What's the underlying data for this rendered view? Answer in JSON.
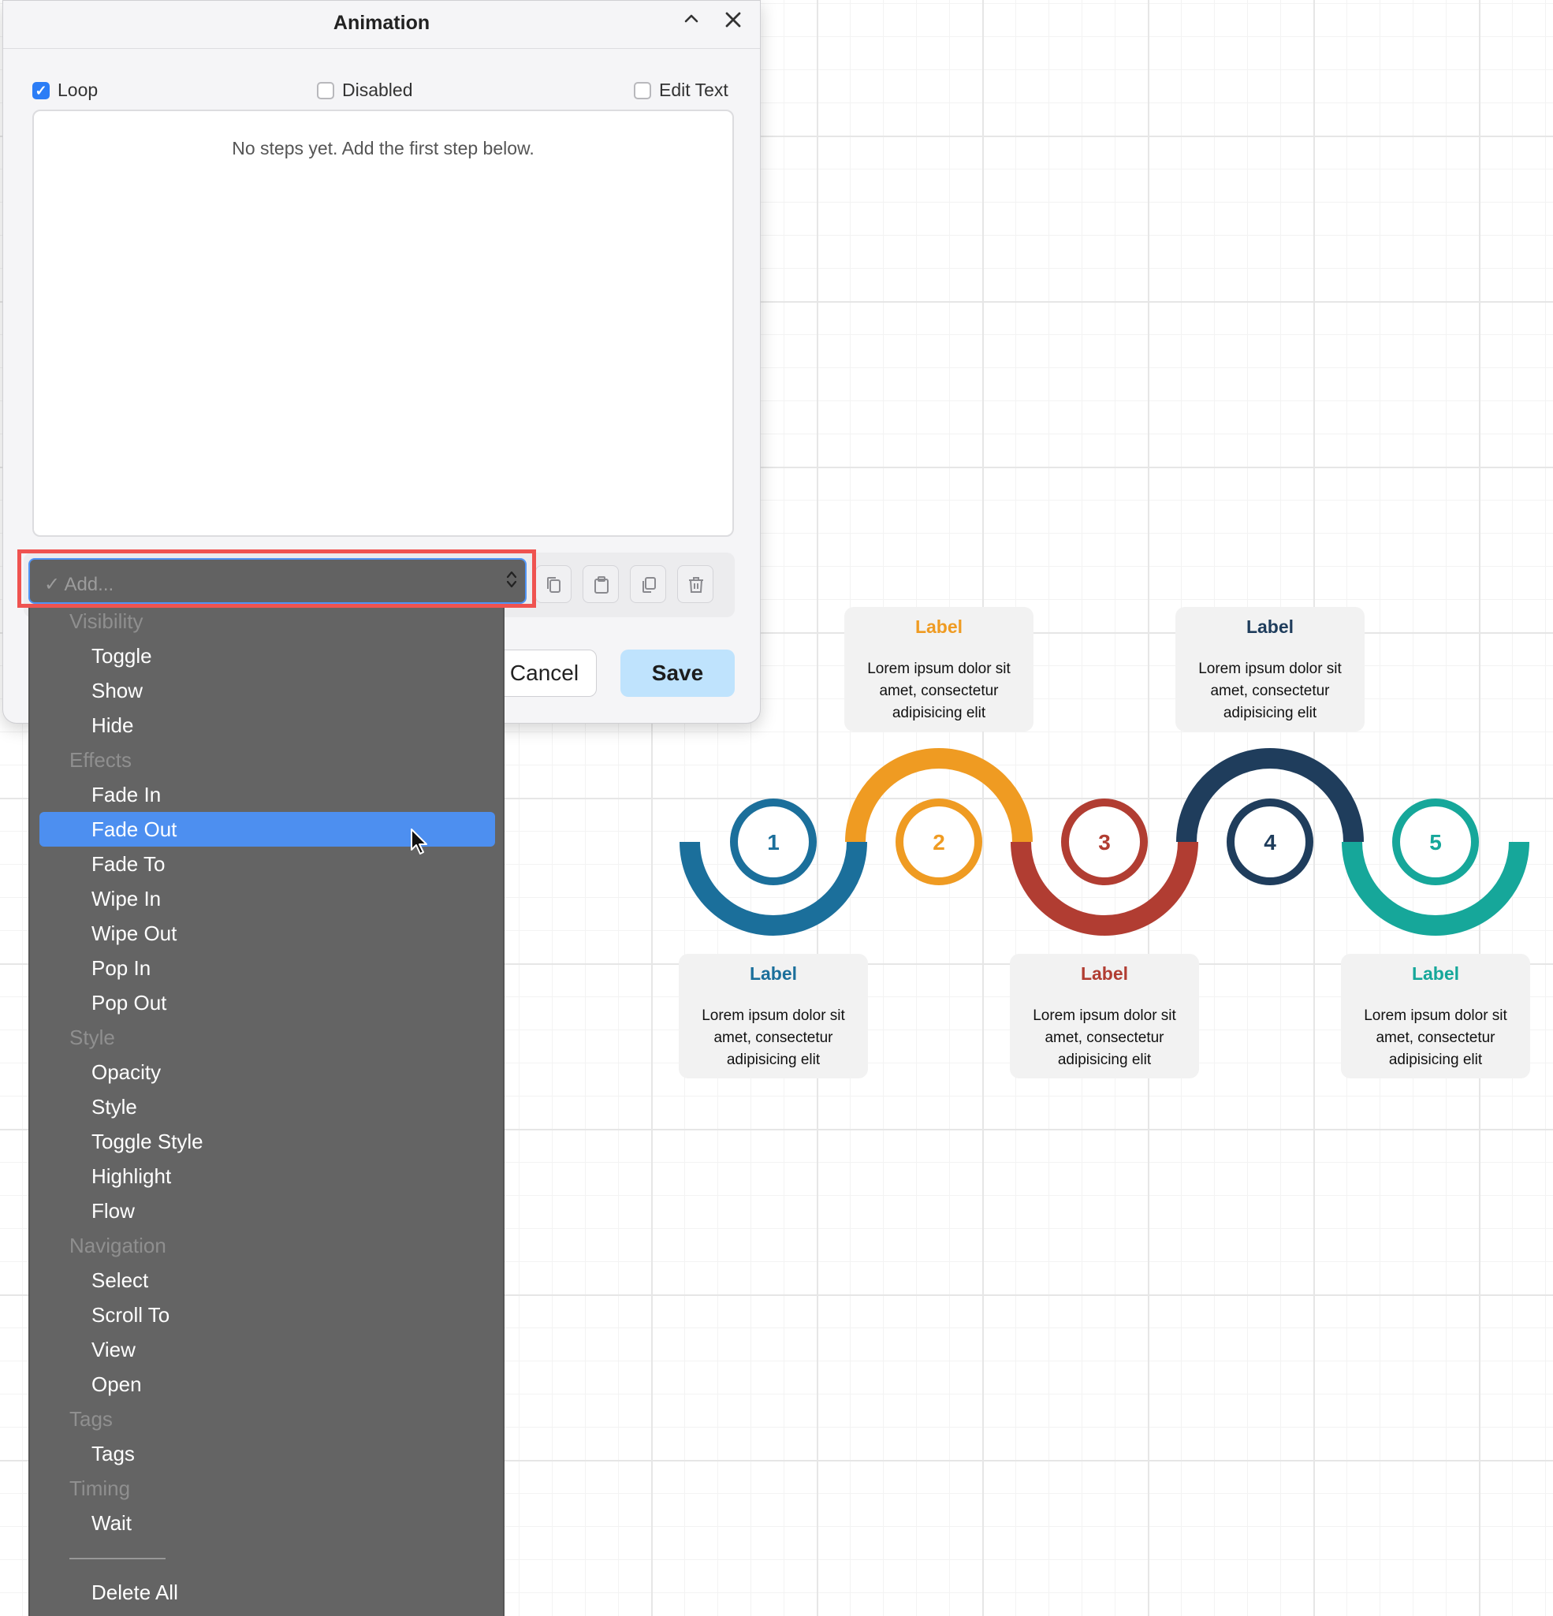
{
  "dialog": {
    "title": "Animation",
    "collapse_icon": "chevron-up-icon",
    "close_icon": "close-icon",
    "options": [
      {
        "label": "Loop",
        "checked": true
      },
      {
        "label": "Disabled",
        "checked": false
      },
      {
        "label": "Edit Text",
        "checked": false
      }
    ],
    "empty_message": "No steps yet. Add the first step below.",
    "add_select": {
      "placeholder": "Add...",
      "check_glyph": "✓"
    },
    "toolbar_icons": [
      "copy-icon",
      "paste-icon",
      "duplicate-icon",
      "delete-icon"
    ],
    "cancel_label": "Cancel",
    "save_label": "Save"
  },
  "dropdown": {
    "selected": "Fade Out",
    "entries": [
      {
        "type": "group",
        "label": "Visibility"
      },
      {
        "type": "item",
        "label": "Toggle"
      },
      {
        "type": "item",
        "label": "Show"
      },
      {
        "type": "item",
        "label": "Hide"
      },
      {
        "type": "group",
        "label": "Effects"
      },
      {
        "type": "item",
        "label": "Fade In"
      },
      {
        "type": "item",
        "label": "Fade Out"
      },
      {
        "type": "item",
        "label": "Fade To"
      },
      {
        "type": "item",
        "label": "Wipe In"
      },
      {
        "type": "item",
        "label": "Wipe Out"
      },
      {
        "type": "item",
        "label": "Pop In"
      },
      {
        "type": "item",
        "label": "Pop Out"
      },
      {
        "type": "group",
        "label": "Style"
      },
      {
        "type": "item",
        "label": "Opacity"
      },
      {
        "type": "item",
        "label": "Style"
      },
      {
        "type": "item",
        "label": "Toggle Style"
      },
      {
        "type": "item",
        "label": "Highlight"
      },
      {
        "type": "item",
        "label": "Flow"
      },
      {
        "type": "group",
        "label": "Navigation"
      },
      {
        "type": "item",
        "label": "Select"
      },
      {
        "type": "item",
        "label": "Scroll To"
      },
      {
        "type": "item",
        "label": "View"
      },
      {
        "type": "item",
        "label": "Open"
      },
      {
        "type": "group",
        "label": "Tags"
      },
      {
        "type": "item",
        "label": "Tags"
      },
      {
        "type": "group",
        "label": "Timing"
      },
      {
        "type": "item",
        "label": "Wait"
      },
      {
        "type": "separator",
        "label": "——————"
      },
      {
        "type": "item",
        "label": "Delete All"
      }
    ]
  },
  "diagram": {
    "steps": [
      {
        "number": "1",
        "color": "#1b6f9b",
        "label": "Label",
        "text": "Lorem ipsum dolor sit amet, consectetur adipisicing elit"
      },
      {
        "number": "2",
        "color": "#ef9b22",
        "label": "Label",
        "text": "Lorem ipsum dolor sit amet, consectetur adipisicing elit"
      },
      {
        "number": "3",
        "color": "#b13d32",
        "label": "Label",
        "text": "Lorem ipsum dolor sit amet, consectetur adipisicing elit"
      },
      {
        "number": "4",
        "color": "#1f3d5c",
        "label": "Label",
        "text": "Lorem ipsum dolor sit amet, consectetur adipisicing elit"
      },
      {
        "number": "5",
        "color": "#16a79a",
        "label": "Label",
        "text": "Lorem ipsum dolor sit amet, consectetur adipisicing elit"
      }
    ]
  }
}
